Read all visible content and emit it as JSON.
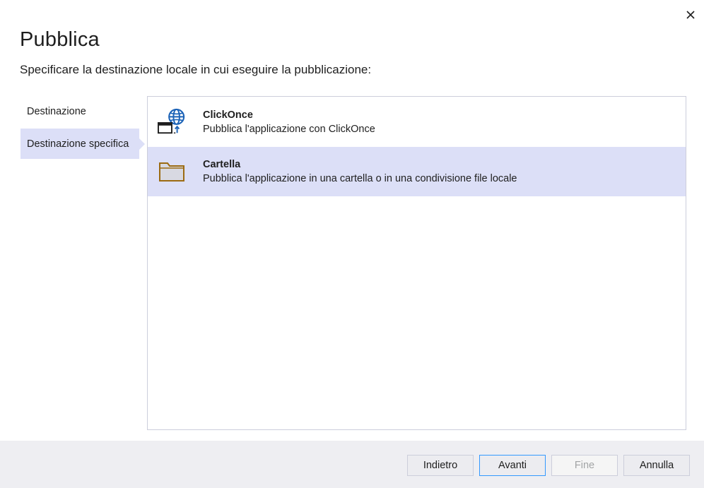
{
  "dialog": {
    "title": "Pubblica",
    "subtitle": "Specificare la destinazione locale in cui eseguire la pubblicazione:",
    "close_icon": "close-icon"
  },
  "steps": [
    {
      "label": "Destinazione",
      "active": false
    },
    {
      "label": "Destinazione specifica",
      "active": true
    }
  ],
  "targets": [
    {
      "title": "ClickOnce",
      "description": "Pubblica l'applicazione con ClickOnce",
      "icon": "clickonce-globe-icon",
      "selected": false
    },
    {
      "title": "Cartella",
      "description": "Pubblica l'applicazione in una cartella o in una condivisione file locale",
      "icon": "folder-icon",
      "selected": true
    }
  ],
  "footer": {
    "back_label": "Indietro",
    "next_label": "Avanti",
    "finish_label": "Fine",
    "cancel_label": "Annulla"
  },
  "colors": {
    "selection": "#dcdff7",
    "accent": "#3399ff",
    "globe_blue": "#1c63b7",
    "folder_gold": "#9c6b12",
    "footer_bg": "#eeeef2"
  }
}
